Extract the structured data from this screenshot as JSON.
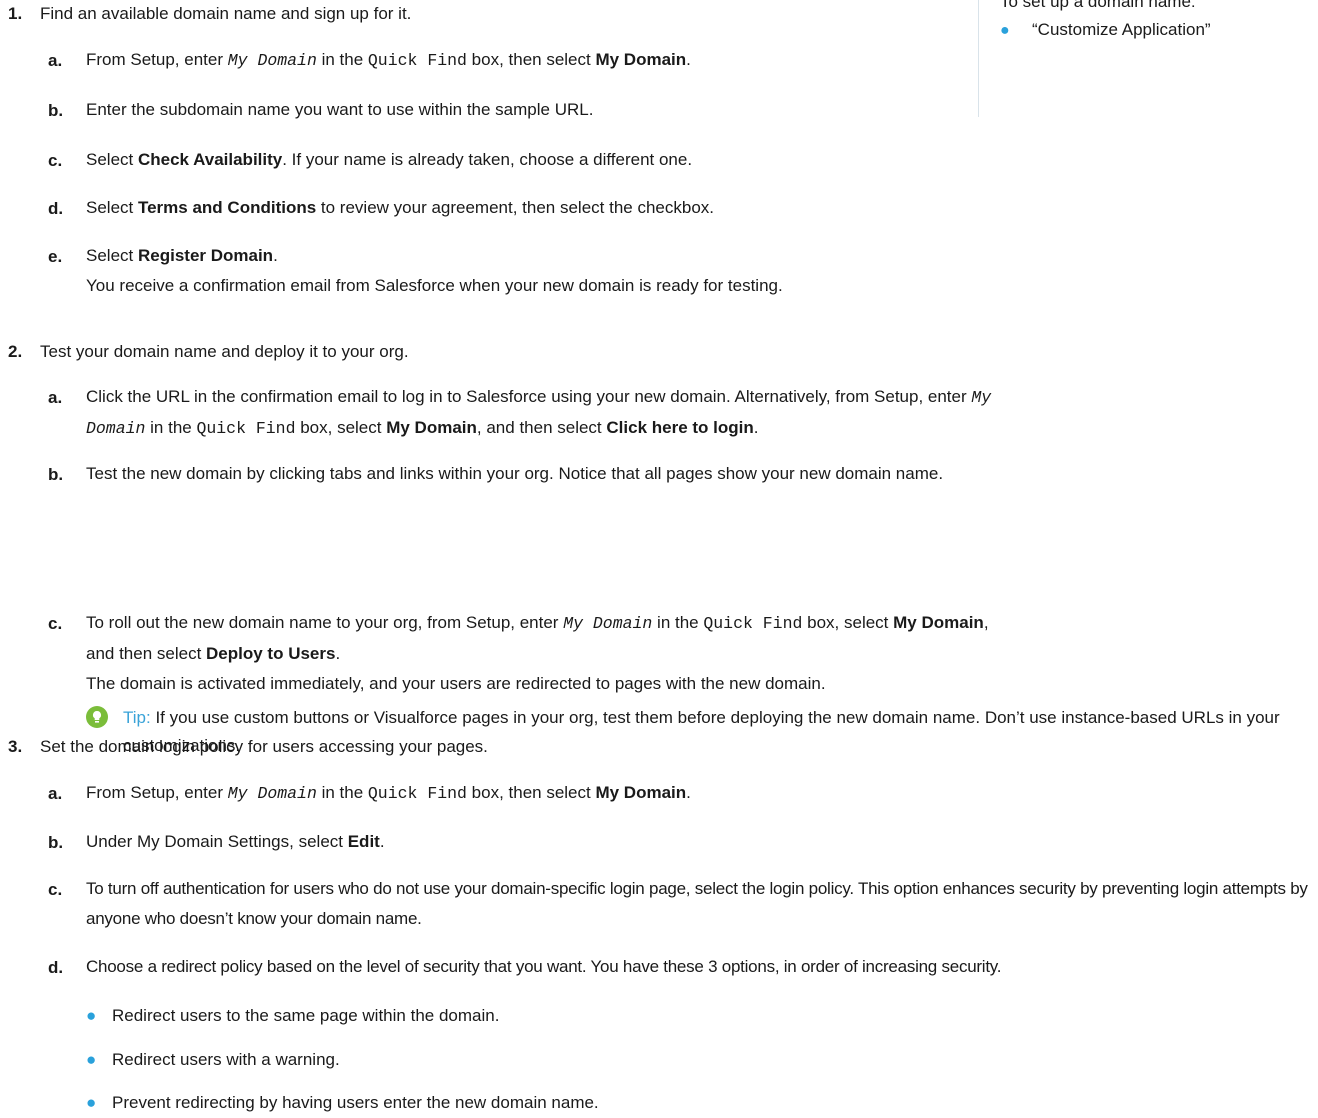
{
  "sidebar": {
    "title": "To set up a domain name:",
    "item": "“Customize Application”"
  },
  "steps": [
    {
      "num": "1.",
      "text": "Find an available domain name and sign up for it.",
      "subs": [
        {
          "letter": "a.",
          "pre": "From Setup, enter ",
          "code1": "My Domain",
          "mid": " in the ",
          "code2": "Quick Find",
          "mid2": " box, then select ",
          "bold": "My Domain",
          "post": "."
        },
        {
          "letter": "b.",
          "text": "Enter the subdomain name you want to use within the sample URL."
        },
        {
          "letter": "c.",
          "pre": "Select ",
          "bold": "Check Availability",
          "post": ". If your name is already taken, choose a different one."
        },
        {
          "letter": "d.",
          "pre": "Select ",
          "bold": "Terms and Conditions",
          "post": " to review your agreement, then select the checkbox."
        },
        {
          "letter": "e.",
          "pre": "Select ",
          "bold": "Register Domain",
          "post": ".",
          "line2": "You receive a confirmation email from Salesforce when your new domain is ready for testing."
        }
      ]
    },
    {
      "num": "2.",
      "text": "Test your domain name and deploy it to your org.",
      "subs": [
        {
          "letter": "a.",
          "pre": "Click the URL in the confirmation email to log in to Salesforce using your new domain. Alternatively, from Setup, enter ",
          "code1a": "My",
          "code1b": "Domain",
          "mid": " in the ",
          "code2": "Quick Find",
          "mid2": " box, select ",
          "bold": "My Domain",
          "mid3": ", and then select ",
          "bold2": "Click here to login",
          "post": "."
        },
        {
          "letter": "b.",
          "text": "Test the new domain by clicking tabs and links within your org. Notice that all pages show your new domain name."
        },
        {
          "letter": "c.",
          "pre": "To roll out the new domain name to your org, from Setup, enter ",
          "code1": "My Domain",
          "mid": " in the ",
          "code2": "Quick Find",
          "mid2": " box, select ",
          "bold": "My Domain",
          ",": "",
          "line2pre": "and then select ",
          "bold2": "Deploy to Users",
          "post": ".",
          "line3": "The domain is activated immediately, and your users are redirected to pages with the new domain."
        }
      ],
      "tip": {
        "label": "Tip:",
        "text": " If you use custom buttons or Visualforce pages in your org, test them before deploying the new domain name. Don’t use instance-based URLs in your customizations."
      }
    },
    {
      "num": "3.",
      "text": "Set the domain login policy for users accessing your pages.",
      "subs": [
        {
          "letter": "a.",
          "pre": "From Setup, enter ",
          "code1": "My Domain",
          "mid": " in the ",
          "code2": "Quick Find",
          "mid2": " box, then select ",
          "bold": "My Domain",
          "post": "."
        },
        {
          "letter": "b.",
          "pre": "Under My Domain Settings, select ",
          "bold": "Edit",
          "post": "."
        },
        {
          "letter": "c.",
          "text": "To turn off authentication for users who do not use your domain-specific login page, select the login policy. This option enhances security by preventing login attempts by anyone who doesn’t know your domain name."
        },
        {
          "letter": "d.",
          "text": "Choose a redirect policy based on the level of security that you want. You have these 3 options, in order of increasing security."
        }
      ],
      "bullets": [
        "Redirect users to the same page within the domain.",
        "Redirect users with a warning.",
        "Prevent redirecting by having users enter the new domain name."
      ]
    }
  ],
  "colors": {
    "accent": "#2aa1db",
    "tip_icon": "#7bbd3a",
    "tip_label": "#3aa3d8",
    "rule": "#d9e3ea"
  }
}
